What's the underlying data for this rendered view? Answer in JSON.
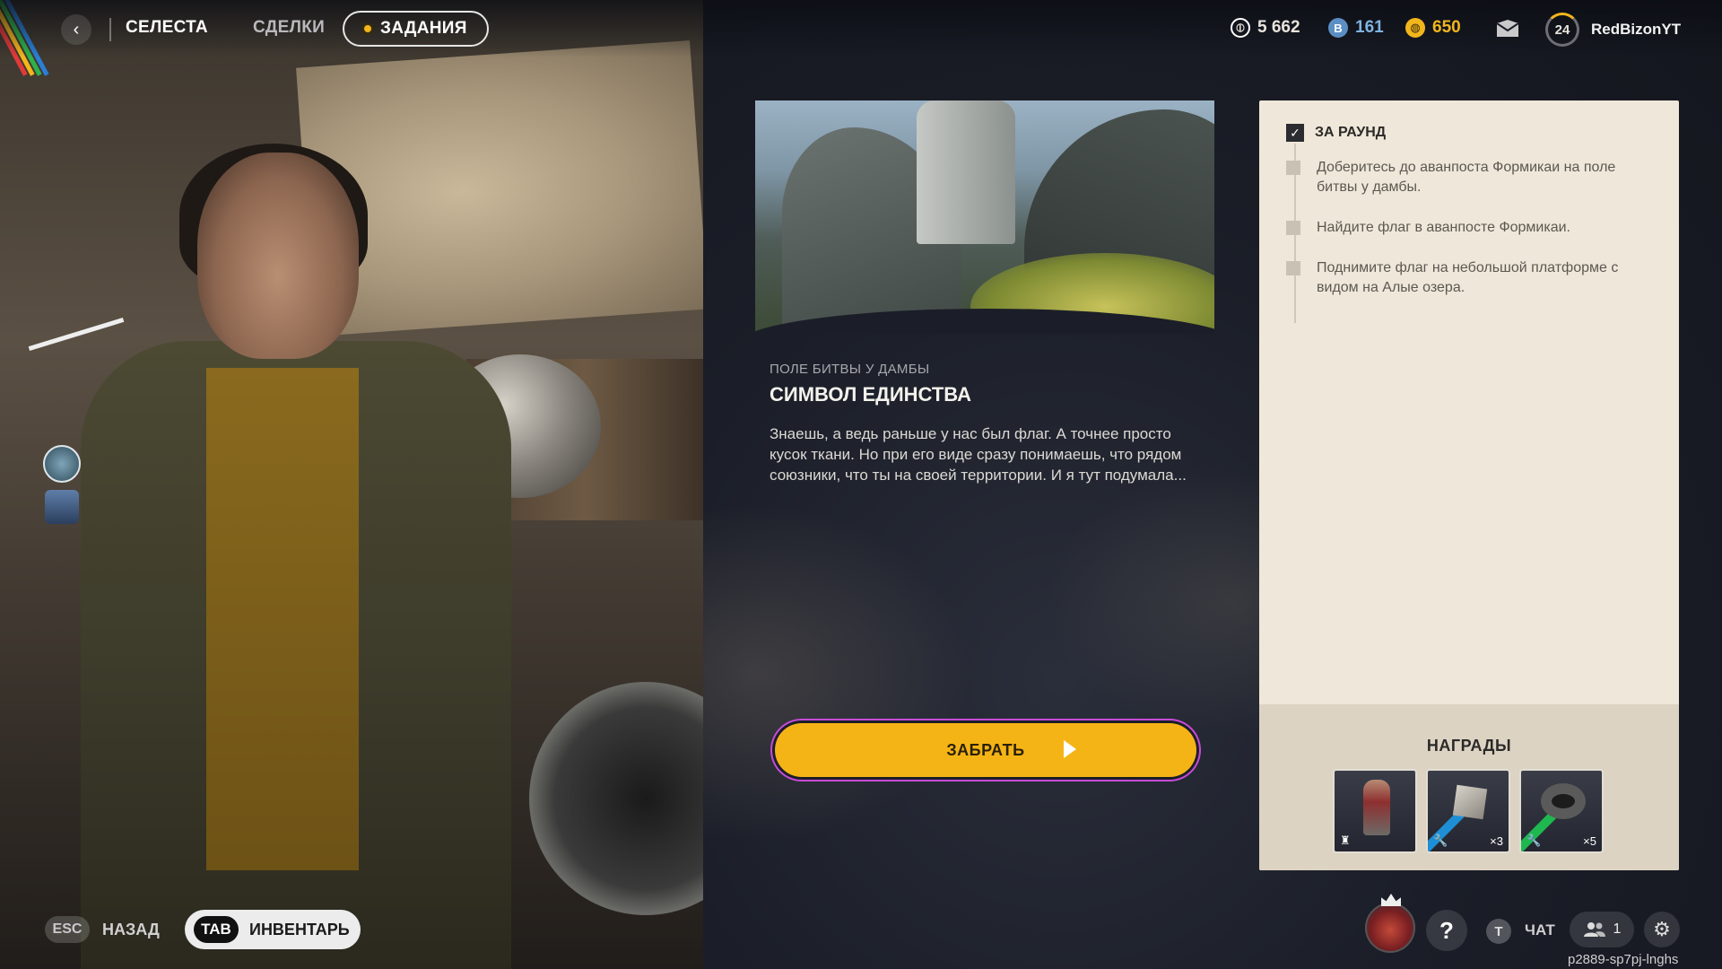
{
  "nav": {
    "tabs": [
      "СЕЛЕСТА",
      "СДЕЛКИ",
      "ЗАДАНИЯ"
    ],
    "active_tab": "ЗАДАНИЯ"
  },
  "currencies": [
    {
      "icon": "credits-icon",
      "value": "5 662",
      "color": "#ffffff"
    },
    {
      "icon": "gem-icon",
      "value": "161",
      "color": "#7fb3e0"
    },
    {
      "icon": "gold-icon",
      "value": "650",
      "color": "#f2b51c"
    }
  ],
  "profile": {
    "level": "24",
    "username": "RedBizonYT"
  },
  "mission": {
    "category": "ПОЛЕ БИТВЫ У ДАМБЫ",
    "title": "СИМВОЛ ЕДИНСТВА",
    "description": "Знаешь, а ведь раньше у нас был флаг. А точнее просто кусок ткани. Но при его виде сразу понимаешь, что рядом союзники, что ты на своей территории. И я тут подумала...",
    "claim_label": "ЗАБРАТЬ"
  },
  "objectives": {
    "header": "ЗА РАУНД",
    "items": [
      "Доберитесь до аванпоста Формикаи на поле битвы у дамбы.",
      "Найдите флаг в аванпосте Формикаи.",
      "Поднимите флаг на небольшой платформе с видом на Алые озера."
    ]
  },
  "rewards": {
    "title": "НАГРАДЫ",
    "items": [
      {
        "name": "character-outfit",
        "count": ""
      },
      {
        "name": "resource-crate",
        "count": "×3"
      },
      {
        "name": "tire-resource",
        "count": "×5"
      }
    ]
  },
  "bottom": {
    "esc_key": "ESC",
    "back_label": "НАЗАД",
    "tab_key": "TAB",
    "inventory_label": "ИНВЕНТАРЬ",
    "chat_key": "T",
    "chat_label": "ЧАТ",
    "party_count": "1",
    "session_id": "p2889-sp7pj-lnghs"
  }
}
